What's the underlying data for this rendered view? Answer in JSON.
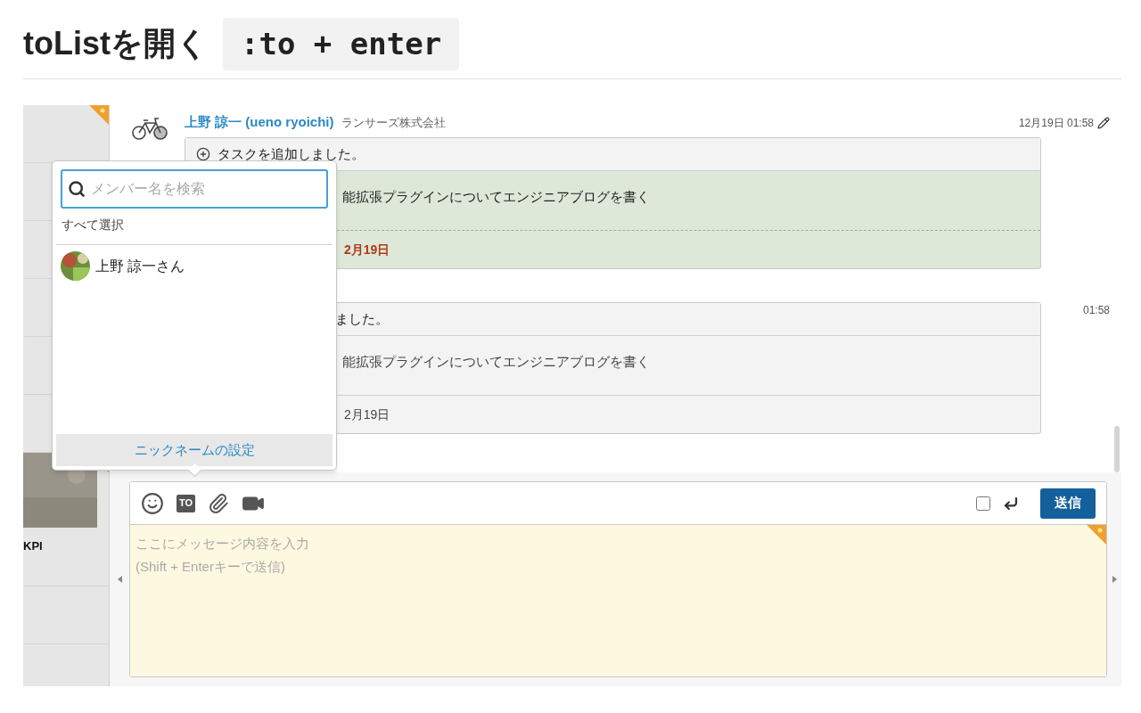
{
  "heading": {
    "title": "toListを開く",
    "shortcut": ":to + enter"
  },
  "sidebar": {
    "label": "KPI"
  },
  "messages": [
    {
      "sender": "上野 諒一 (ueno ryoichi)",
      "company": "ランサーズ株式会社",
      "time": "12月19日 01:58",
      "editable": true,
      "task": {
        "header": "タスクを追加しました。",
        "text": "能拡張プラグインについてエンジニアブログを書く",
        "due": "2月19日",
        "highlighted": true
      }
    },
    {
      "time": "01:58",
      "editable": false,
      "task": {
        "header": "ました。",
        "text": "能拡張プラグインについてエンジニアブログを書く",
        "due": "2月19日",
        "highlighted": false
      }
    }
  ],
  "to_popup": {
    "search_placeholder": "メンバー名を検索",
    "select_all": "すべて選択",
    "members": [
      {
        "name": "上野 諒一さん"
      }
    ],
    "footer_link": "ニックネームの設定"
  },
  "composer": {
    "to_button": "TO",
    "enter_to_send": false,
    "send_label": "送信",
    "placeholder": "ここにメッセージ内容を入力\n(Shift + Enterキーで送信)"
  }
}
